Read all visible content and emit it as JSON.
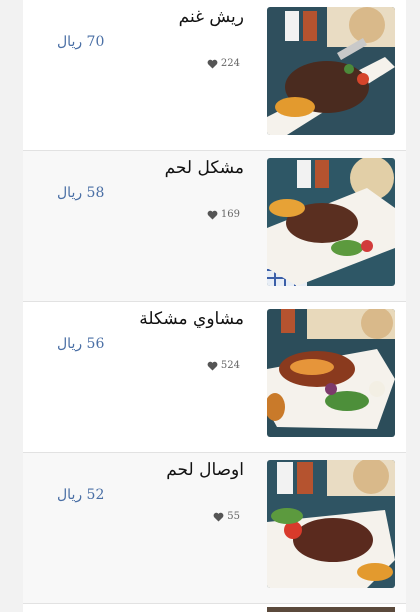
{
  "menu": {
    "items": [
      {
        "name": "ريش غنم",
        "price": "70 ريال",
        "likes": "224",
        "heart_icon": "heart-icon",
        "image": "lamb-ribs-plate"
      },
      {
        "name": "مشكل لحم",
        "price": "58 ريال",
        "likes": "169",
        "heart_icon": "heart-icon",
        "image": "mixed-meat-plate"
      },
      {
        "name": "مشاوي مشكلة",
        "price": "56 ريال",
        "likes": "524",
        "heart_icon": "heart-icon",
        "image": "mixed-grill-plate"
      },
      {
        "name": "اوصال لحم",
        "price": "52 ريال",
        "likes": "55",
        "heart_icon": "heart-icon",
        "image": "meat-cubes-plate"
      }
    ]
  },
  "colors": {
    "price": "#4a6fa5",
    "page_bg": "#f2f2f2",
    "alt_row_bg": "#f8f8f8",
    "heart": "#555555"
  }
}
